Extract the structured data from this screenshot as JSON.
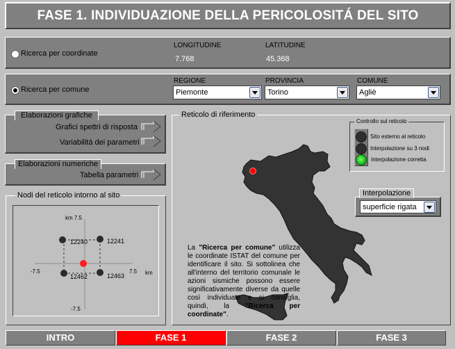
{
  "header": {
    "title": "FASE 1. INDIVIDUAZIONE DELLA PERICOLOSITÁ DEL SITO"
  },
  "coord_search": {
    "radio_label": "Ricerca per coordinate",
    "selected": false,
    "longitude_label": "LONGITUDINE",
    "longitude_value": "7.768",
    "latitude_label": "LATITUDINE",
    "latitude_value": "45.368"
  },
  "comune_search": {
    "radio_label": "Ricerca per comune",
    "selected": true,
    "regione_label": "REGIONE",
    "regione_value": "Piemonte",
    "provincia_label": "PROVINCIA",
    "provincia_value": "Torino",
    "comune_label": "COMUNE",
    "comune_value": "Agliè"
  },
  "graphic_elaborations": {
    "title": "Elaborazioni grafiche",
    "items": [
      {
        "label": "Grafici spettri di risposta",
        "icon": "arrow-right-icon"
      },
      {
        "label": "Variabilitá dei parametri",
        "icon": "arrow-right-icon"
      }
    ]
  },
  "numeric_elaborations": {
    "title": "Elaborazioni numeriche",
    "items": [
      {
        "label": "Tabella parametri",
        "icon": "arrow-right-icon"
      }
    ]
  },
  "grid_nodes": {
    "title": "Nodi del reticolo intorno al sito",
    "axis": {
      "y_top": "km 7.5",
      "y_bottom": "-7.5",
      "x_left": "-7.5",
      "x_right": "7.5",
      "x_unit": "km"
    },
    "nodes": [
      "12240",
      "12241",
      "12462",
      "12463"
    ],
    "site_color": "#ff2020",
    "node_color": "#2a2a2a"
  },
  "reference_grid": {
    "title": "Reticolo di riferimento",
    "map_color": "#333333",
    "site_marker_color": "#ff0000",
    "control": {
      "title": "Controllo sul reticolo",
      "lights": [
        {
          "label": "Sito esterno al reticolo",
          "state": "off"
        },
        {
          "label": "Interpolazione su 3 nodi",
          "state": "off"
        },
        {
          "label": "Interpolazione corretta",
          "state": "on"
        }
      ]
    },
    "interpolation": {
      "title": "Interpolazione",
      "value": "superficie rigata"
    },
    "description": {
      "p1": "La ",
      "b1": "\"Ricerca per comune\"",
      "p2": " utilizza le coordinate ISTAT del comune per identificare il sito. Si sottolinea che all'interno del territorio comunale le azioni sismiche possono essere significativamente diverse da quelle così individuate e si consiglia, quindi, la ",
      "b2": "\"Ricerca per coordinate\"",
      "p3": "."
    }
  },
  "nav_tabs": [
    {
      "label": "INTRO",
      "active": false
    },
    {
      "label": "FASE 1",
      "active": true
    },
    {
      "label": "FASE 2",
      "active": false
    },
    {
      "label": "FASE 3",
      "active": false
    }
  ]
}
